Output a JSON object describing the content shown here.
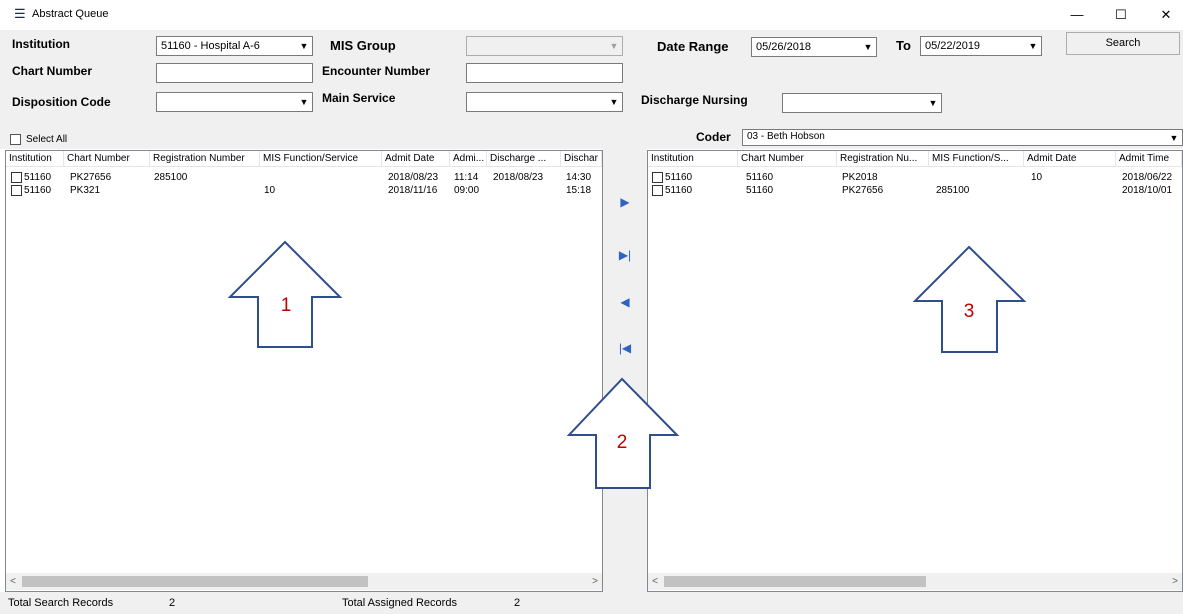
{
  "window": {
    "title": "Abstract Queue",
    "minimize_glyph": "—",
    "maximize_glyph": "☐",
    "close_glyph": "✕"
  },
  "filters": {
    "institution_label": "Institution",
    "institution_value": "51160 - Hospital A-6",
    "mis_group_label": "MIS Group",
    "mis_group_value": "",
    "date_range_label": "Date Range",
    "date_from": "05/26/2018",
    "to_label": "To",
    "date_to": "05/22/2019",
    "search_label": "Search",
    "chart_number_label": "Chart Number",
    "chart_number_value": "",
    "encounter_number_label": "Encounter Number",
    "encounter_number_value": "",
    "disposition_code_label": "Disposition Code",
    "disposition_code_value": "",
    "main_service_label": "Main Service",
    "main_service_value": "",
    "discharge_nursing_label": "Discharge Nursing",
    "discharge_nursing_value": ""
  },
  "left_panel": {
    "select_all_label": "Select All",
    "columns": [
      "Institution",
      "Chart Number",
      "Registration Number",
      "MIS Function/Service",
      "Admit Date",
      "Admi...",
      "Discharge ...",
      "Dischar"
    ],
    "rows": [
      [
        "51160",
        "PK27656",
        "285100",
        "",
        "2018/08/23",
        "11:14",
        "2018/08/23",
        "14:30"
      ],
      [
        "51160",
        "PK321",
        "",
        "10",
        "2018/11/16",
        "09:00",
        "",
        "15:18"
      ]
    ]
  },
  "right_panel": {
    "coder_label": "Coder",
    "coder_value": "03 - Beth Hobson",
    "columns": [
      "Institution",
      "Chart Number",
      "Registration Nu...",
      "MIS Function/S...",
      "Admit Date",
      "Admit Time"
    ],
    "rows": [
      [
        "51160",
        "51160",
        "PK2018",
        "",
        "10",
        "2018/06/22"
      ],
      [
        "51160",
        "51160",
        "PK27656",
        "285100",
        "",
        "2018/10/01"
      ]
    ]
  },
  "move_buttons": {
    "move_right": "▶",
    "move_all_right": "▶|",
    "move_left": "◀",
    "move_all_left": "|◀"
  },
  "annotations": {
    "arrow1": "1",
    "arrow2": "2",
    "arrow3": "3",
    "arrow_color": "#2f4e8c",
    "number_color": "#c00000"
  },
  "status": {
    "total_search_label": "Total Search Records",
    "total_search_value": "2",
    "total_assigned_label": "Total Assigned Records",
    "total_assigned_value": "2"
  },
  "scrollbar": {
    "left_arrow": "<",
    "right_arrow": ">"
  }
}
